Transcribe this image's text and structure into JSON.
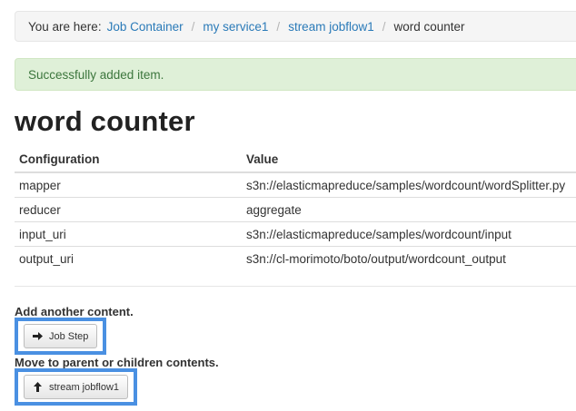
{
  "breadcrumb": {
    "prefix": "You are here:",
    "items": [
      "Job Container",
      "my service1",
      "stream jobflow1"
    ],
    "separator": "/",
    "current": "word counter"
  },
  "alert": {
    "message": "Successfully added item."
  },
  "page": {
    "title": "word counter"
  },
  "table": {
    "headers": [
      "Configuration",
      "Value"
    ],
    "rows": [
      {
        "key": "mapper",
        "value": "s3n://elasticmapreduce/samples/wordcount/wordSplitter.py"
      },
      {
        "key": "reducer",
        "value": "aggregate"
      },
      {
        "key": "input_uri",
        "value": "s3n://elasticmapreduce/samples/wordcount/input"
      },
      {
        "key": "output_uri",
        "value": "s3n://cl-morimoto/boto/output/wordcount_output"
      }
    ]
  },
  "actions": {
    "add_label": "Add another content.",
    "add_button": "Job Step",
    "add_icon": "arrow-right-icon",
    "move_label": "Move to parent or children contents.",
    "move_button": "stream jobflow1",
    "move_icon": "arrow-up-icon"
  },
  "colors": {
    "link": "#2a7ab8",
    "alert_bg": "#dff0d8",
    "alert_text": "#3c763d",
    "highlight": "#4a90e2"
  }
}
